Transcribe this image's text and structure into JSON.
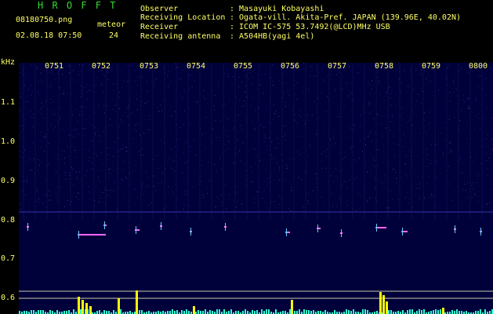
{
  "header": {
    "brand": "H R O F F T",
    "filename": "08180750.png",
    "datetime": "02.08.18 07:50",
    "meteor_label": "meteor",
    "meteor_count": "24",
    "fields": [
      {
        "label": "Observer",
        "value": ": Masayuki Kobayashi"
      },
      {
        "label": "Receiving Location",
        "value": ": Ogata-vill. Akita-Pref. JAPAN (139.96E, 40.02N)"
      },
      {
        "label": "Receiver",
        "value": ": ICOM IC-575 53.7492(@LCD)MHz USB"
      },
      {
        "label": "Receiving antenna",
        "value": ": A504HB(yagi 4el)"
      }
    ]
  },
  "axes": {
    "y_unit": "kHz",
    "y_ticks": [
      "1.1",
      "1.0",
      "0.9",
      "0.8",
      "0.7",
      "0.6"
    ],
    "x_ticks": [
      "0751",
      "0752",
      "0753",
      "0754",
      "0755",
      "0756",
      "0757",
      "0758",
      "0759",
      "0800"
    ]
  },
  "colors": {
    "header_text": "#ffff66",
    "brand": "#33dd33",
    "background": "#00003a",
    "meteor_trace": "#ff66ff",
    "echo_bars": "#ffff00"
  }
}
